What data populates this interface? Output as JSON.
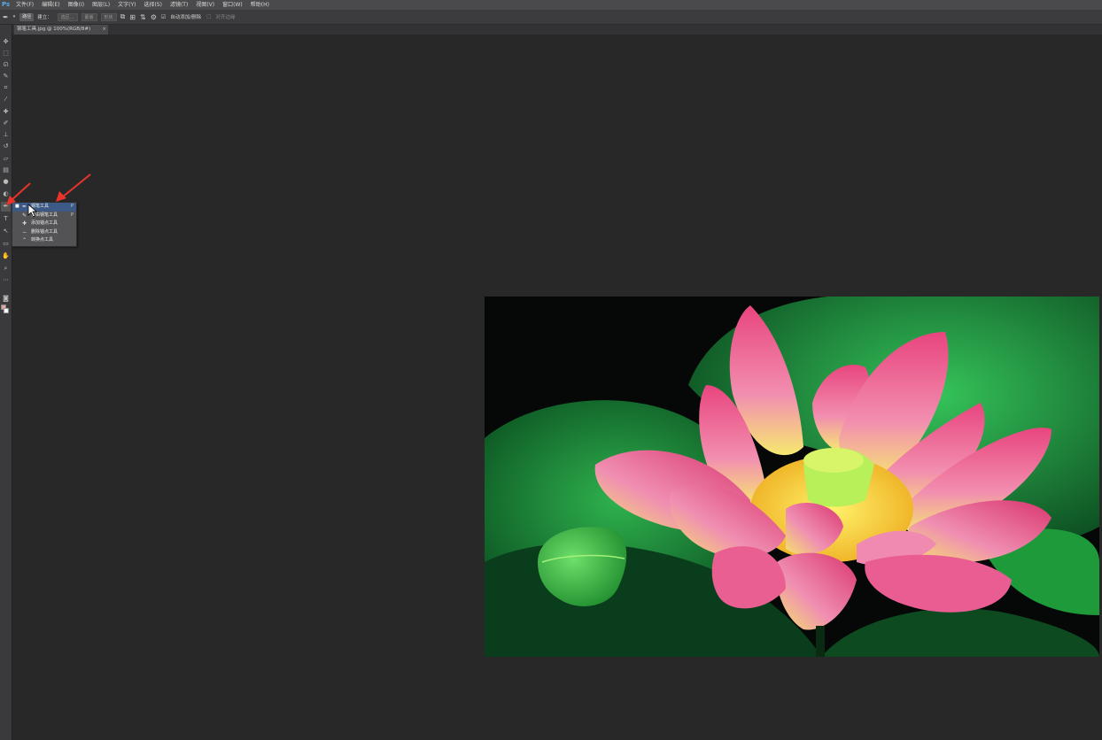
{
  "menubar": {
    "logo": "Ps",
    "items": [
      "文件(F)",
      "编辑(E)",
      "图像(I)",
      "图层(L)",
      "文字(Y)",
      "选择(S)",
      "滤镜(T)",
      "视图(V)",
      "窗口(W)",
      "帮助(H)"
    ]
  },
  "options": {
    "mode_select": "路径",
    "make_label": "建立：",
    "selection_btn": "选区...",
    "mask_btn": "蒙版",
    "shape_btn": "形状",
    "auto_add_label": "自动添加/删除",
    "align_edges_label": "对齐边缘"
  },
  "document": {
    "tab_title": "钢笔工具.jpg @ 100%(RGB/8#)",
    "close": "×"
  },
  "flyout": {
    "items": [
      {
        "label": "钢笔工具",
        "shortcut": "P",
        "selected": true
      },
      {
        "label": "自由钢笔工具",
        "shortcut": "P",
        "selected": false
      },
      {
        "label": "添加锚点工具",
        "shortcut": "",
        "selected": false
      },
      {
        "label": "删除锚点工具",
        "shortcut": "",
        "selected": false
      },
      {
        "label": "转换点工具",
        "shortcut": "",
        "selected": false
      }
    ]
  },
  "colors": {
    "menubar": "#4a4a4c",
    "canvas": "#282828",
    "flyout_selected": "#3d5a86",
    "arrow": "#e8342a",
    "foreground_swatch": "#e2a7a2",
    "background_swatch": "#ffffff"
  },
  "toolbar": {
    "icons": [
      "move-icon",
      "marquee-icon",
      "lasso-icon",
      "quick-select-icon",
      "crop-icon",
      "eyedropper-icon",
      "healing-icon",
      "brush-icon",
      "stamp-icon",
      "history-brush-icon",
      "eraser-icon",
      "gradient-icon",
      "blur-icon",
      "dodge-icon",
      "pen-icon",
      "type-icon",
      "path-select-icon",
      "shape-icon",
      "hand-icon",
      "zoom-icon"
    ]
  }
}
